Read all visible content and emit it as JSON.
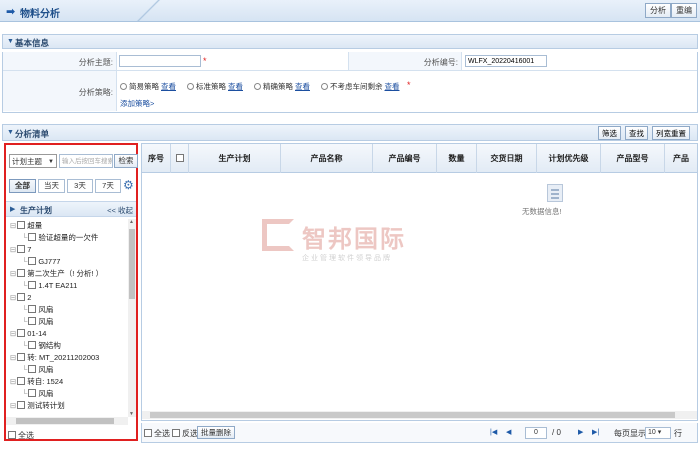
{
  "header": {
    "title": "物料分析",
    "analyze_label": "分析",
    "reset_label": "重编"
  },
  "basic": {
    "section_title": "基本信息",
    "subject_label": "分析主题:",
    "subject_value": "",
    "code_label": "分析编号:",
    "code_value": "WLFX_20220416001",
    "policy_label": "分析策略:",
    "policies": [
      "简易策略",
      "标准策略",
      "精确策略",
      "不考虑车间剩余"
    ],
    "view_label": "查看",
    "add_policy": "添加策略>"
  },
  "list": {
    "section_title": "分析清单",
    "filter_label": "筛选",
    "query_label": "查找",
    "columns_label": "列宽重置"
  },
  "left": {
    "select_value": "计划主题",
    "search_placeholder": "输入后按回车搜索",
    "search_button": "检索",
    "date_buttons": [
      "全部",
      "当天",
      "3天",
      "7天"
    ],
    "panel_title": "生产计划",
    "collapse": "<< 收起",
    "tree": [
      {
        "label": "超量",
        "level": 0
      },
      {
        "label": "验证超量的一欠件",
        "level": 1
      },
      {
        "label": "7",
        "level": 0
      },
      {
        "label": "GJ777",
        "level": 1
      },
      {
        "label": "第二次生产（! 分析! ）",
        "level": 0
      },
      {
        "label": "1.4T EA211",
        "level": 1
      },
      {
        "label": "2",
        "level": 0
      },
      {
        "label": "风扇",
        "level": 1
      },
      {
        "label": "风扇",
        "level": 1
      },
      {
        "label": "01-14",
        "level": 0
      },
      {
        "label": "钢结构",
        "level": 1
      },
      {
        "label": "转: MT_20211202003",
        "level": 0
      },
      {
        "label": "风扇",
        "level": 1
      },
      {
        "label": "转自: 1524",
        "level": 0
      },
      {
        "label": "风扇",
        "level": 1
      },
      {
        "label": "测试转计划",
        "level": 0
      }
    ],
    "select_all": "全选"
  },
  "grid": {
    "columns": [
      "序号",
      "",
      "生产计划",
      "产品名称",
      "产品编号",
      "数量",
      "交货日期",
      "计划优先级",
      "产品型号",
      "产品"
    ],
    "empty_text": "无数据信息!",
    "watermark_big": "智邦国际",
    "watermark_small": "企业管理软件领导品牌"
  },
  "pager": {
    "select_all": "全选",
    "invert": "反选",
    "batch_delete": "批量删除",
    "page_value": "0",
    "page_total": "/ 0",
    "per_page_label": "每页显示",
    "per_page_value": "10",
    "row_unit": "行"
  }
}
